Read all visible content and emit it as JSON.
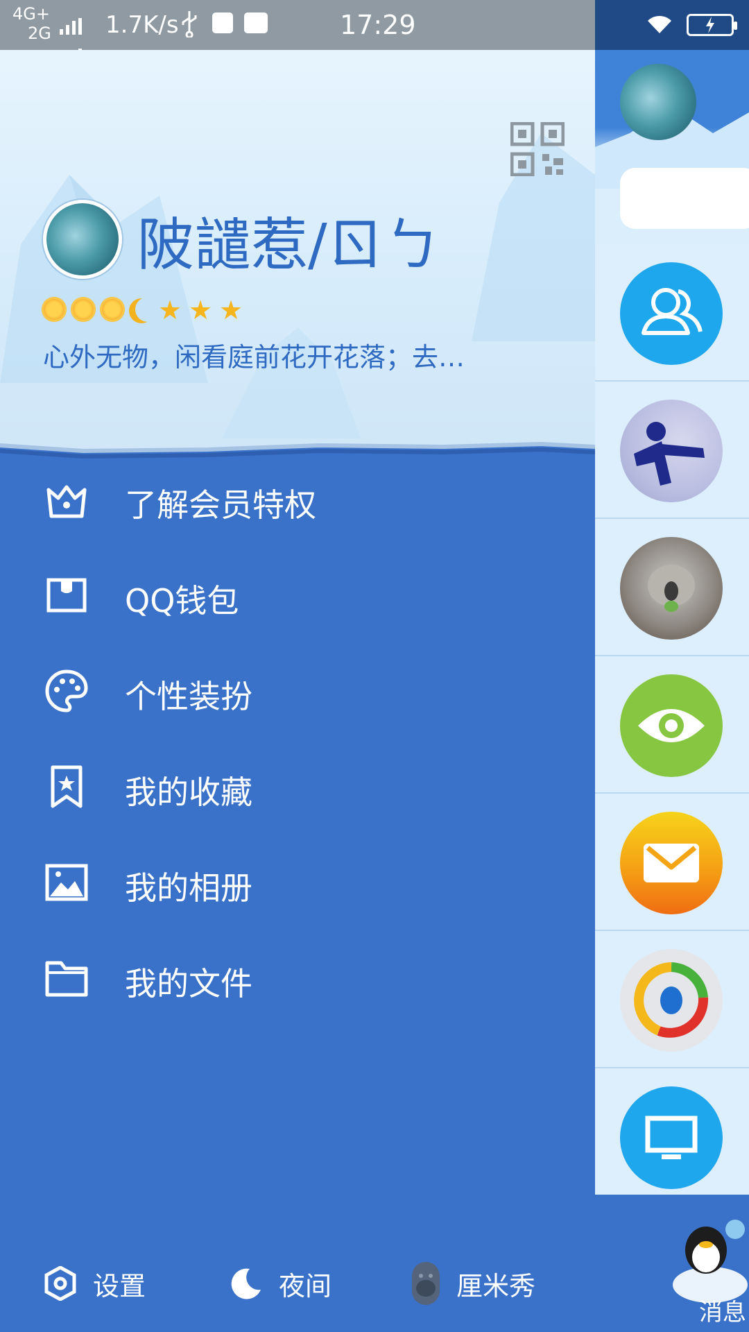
{
  "status_bar": {
    "network_type_top": "4G+",
    "network_type_bottom": "2G",
    "net_speed": "1.7K/s",
    "time": "17:29",
    "icons": [
      "signal-icon",
      "usb-icon",
      "notification-icon",
      "alipay-icon",
      "wifi-icon",
      "battery-charging-icon"
    ]
  },
  "profile": {
    "username": "陂譴惹/ㄖㄅ",
    "signature": "心外无物，闲看庭前花开花落；去…",
    "level_icons": [
      "sun",
      "sun",
      "sun",
      "moon",
      "star",
      "star",
      "star"
    ]
  },
  "menu": [
    {
      "label": "了解会员特权",
      "icon": "crown-icon"
    },
    {
      "label": "QQ钱包",
      "icon": "wallet-icon"
    },
    {
      "label": "个性装扮",
      "icon": "palette-icon"
    },
    {
      "label": "我的收藏",
      "icon": "bookmark-star-icon"
    },
    {
      "label": "我的相册",
      "icon": "photo-icon"
    },
    {
      "label": "我的文件",
      "icon": "folder-icon"
    }
  ],
  "bottom_bar": {
    "settings": "设置",
    "night": "夜间",
    "cmshow": "厘米秀"
  },
  "peek_panel": {
    "rows": [
      "contacts-icon",
      "group-avatar",
      "koala-avatar",
      "eye-icon",
      "mail-icon",
      "qq-news-icon",
      "monitor-icon"
    ],
    "tab_label": "消息"
  },
  "colors": {
    "drawer_blue": "#3a72c9",
    "header_light": "#e6f4fd",
    "title_blue": "#2e6ac2"
  }
}
